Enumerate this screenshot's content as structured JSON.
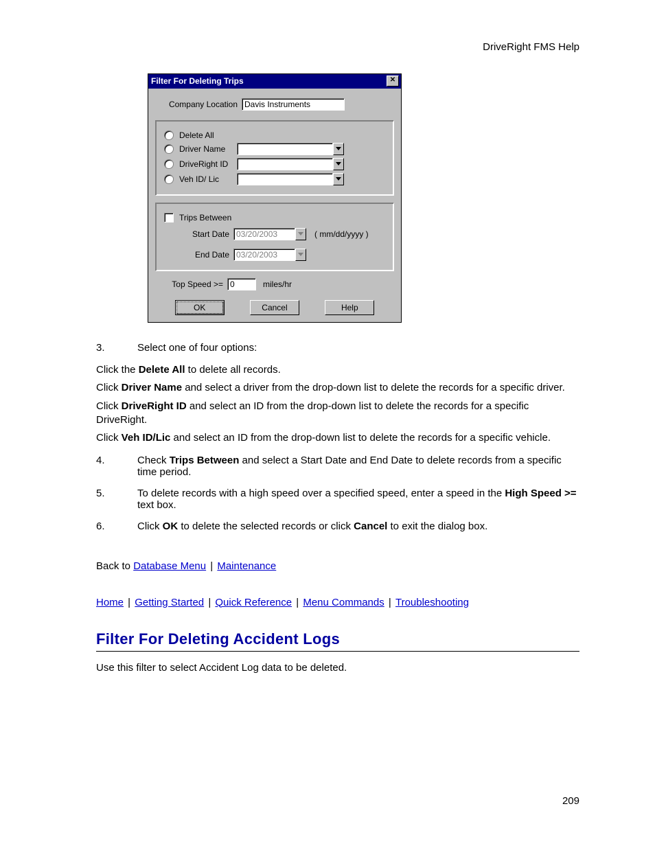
{
  "header": {
    "right": "DriveRight FMS Help"
  },
  "page_number": "209",
  "dialog": {
    "title": "Filter For Deleting Trips",
    "close_glyph": "✕",
    "company_location_label": "Company Location",
    "company_location_value": "Davis Instruments",
    "radios": {
      "delete_all": "Delete All",
      "driver_name": "Driver Name",
      "driveright_id": "DriveRight ID",
      "veh_id_lic": "Veh ID/ Lic"
    },
    "trips_between_label": "Trips Between",
    "start_date_label": "Start Date",
    "start_date_value": "03/20/2003",
    "date_format_hint": "( mm/dd/yyyy )",
    "end_date_label": "End Date",
    "end_date_value": "03/20/2003",
    "top_speed_label": "Top Speed  >=",
    "top_speed_value": "0",
    "top_speed_units": "miles/hr",
    "buttons": {
      "ok": "OK",
      "cancel": "Cancel",
      "help": "Help"
    }
  },
  "steps": {
    "s3_num": "3.",
    "s3_text": "Select one of four options:",
    "p1a": "Click the ",
    "p1b": "Delete All",
    "p1c": " to delete all records.",
    "p2a": "Click ",
    "p2b": "Driver Name",
    "p2c": " and select a driver from the drop-down list to delete the records for a specific driver.",
    "p3a": "Click ",
    "p3b": "DriveRight ID",
    "p3c": " and select an ID from the drop-down list to delete the records for a specific DriveRight.",
    "p4a": "Click ",
    "p4b": "Veh ID/Lic",
    "p4c": " and select an ID from the drop-down list to delete the records for a specific vehicle.",
    "s4_num": "4.",
    "s4a": "Check ",
    "s4b": "Trips Between",
    "s4c": " and select a Start Date and End Date to delete records from a specific time period.",
    "s5_num": "5.",
    "s5a": "To delete records with a high speed over a specified speed, enter a speed in the ",
    "s5b": "High Speed >=",
    "s5c": " text box.",
    "s6_num": "6.",
    "s6a": "Click ",
    "s6b": "OK",
    "s6c": " to delete the selected records or click ",
    "s6d": "Cancel",
    "s6e": " to exit the dialog box."
  },
  "backto": {
    "prefix": "Back to ",
    "link1": "Database Menu",
    "sep": " | ",
    "link2": "Maintenance"
  },
  "nav": {
    "home": "Home",
    "getting_started": "Getting Started",
    "quick_reference": "Quick Reference",
    "menu_commands": "Menu Commands",
    "troubleshooting": "Troubleshooting",
    "sep": " | "
  },
  "section": {
    "heading": "Filter For Deleting Accident Logs",
    "intro": "Use this filter to select Accident Log data to be deleted."
  }
}
